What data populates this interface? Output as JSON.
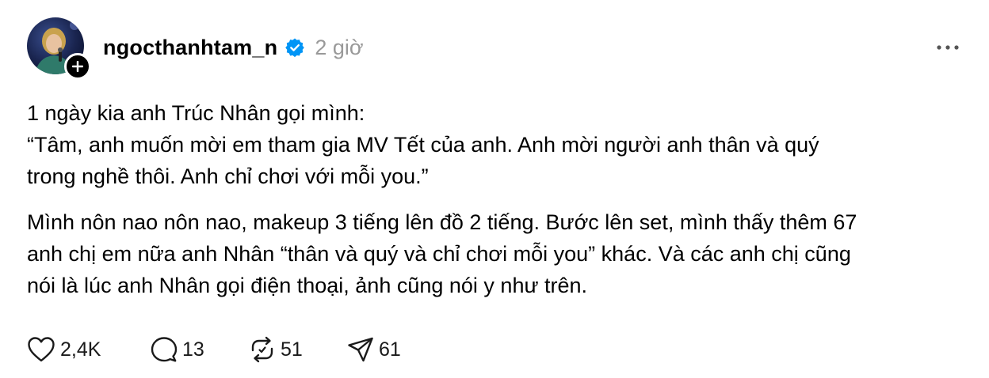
{
  "post": {
    "username": "ngocthanhtam_n",
    "timestamp": "2 giờ",
    "paragraphs": [
      {
        "lines": [
          "1 ngày kia anh Trúc Nhân gọi mình:",
          "“Tâm, anh muốn mời em tham gia MV Tết của anh. Anh mời người anh thân và quý",
          "trong nghề thôi. Anh chỉ chơi với mỗi you.”"
        ]
      },
      {
        "lines": [
          "Mình nôn nao nôn nao, makeup 3 tiếng lên đồ 2 tiếng. Bước lên set, mình thấy thêm 67",
          "anh chị em nữa anh Nhân “thân và quý và chỉ chơi mỗi you” khác. Và các anh chị cũng",
          "nói là lúc anh Nhân gọi điện thoại, ảnh cũng nói y như trên."
        ]
      }
    ],
    "actions": {
      "likes": "2,4K",
      "comments": "13",
      "reposts": "51",
      "shares": "61"
    }
  },
  "icons": {
    "avatar": "avatar",
    "follow": "plus-icon",
    "verified": "verified-badge-icon",
    "more": "more-icon",
    "like": "heart-icon",
    "comment": "comment-icon",
    "repost": "repost-icon",
    "share": "share-icon"
  },
  "colors": {
    "verified": "#0095f6",
    "muted": "#999999",
    "text": "#000000"
  }
}
